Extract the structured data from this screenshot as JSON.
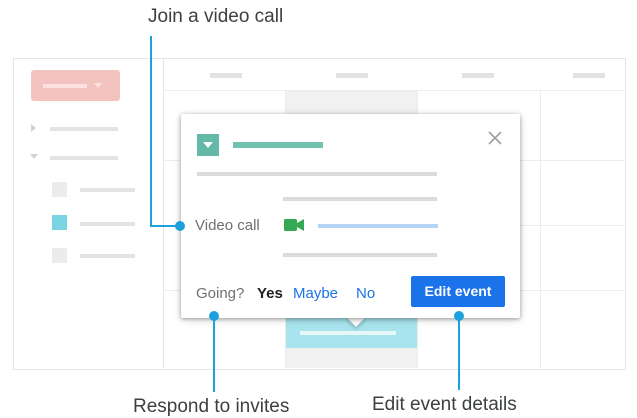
{
  "callouts": {
    "video": "Join a video call",
    "respond": "Respond to invites",
    "edit": "Edit event details"
  },
  "popup": {
    "video_label": "Video call",
    "going_label": "Going?",
    "rsvp": {
      "yes": "Yes",
      "maybe": "Maybe",
      "no": "No"
    },
    "edit_button": "Edit event"
  },
  "colors": {
    "callout": "#1da1dc",
    "primary_button": "#1a73e8",
    "event_color": "#63b8a7",
    "create_button": "#f3c3c0"
  },
  "icons": [
    "close-icon",
    "camera-icon",
    "chevron-down-icon"
  ]
}
